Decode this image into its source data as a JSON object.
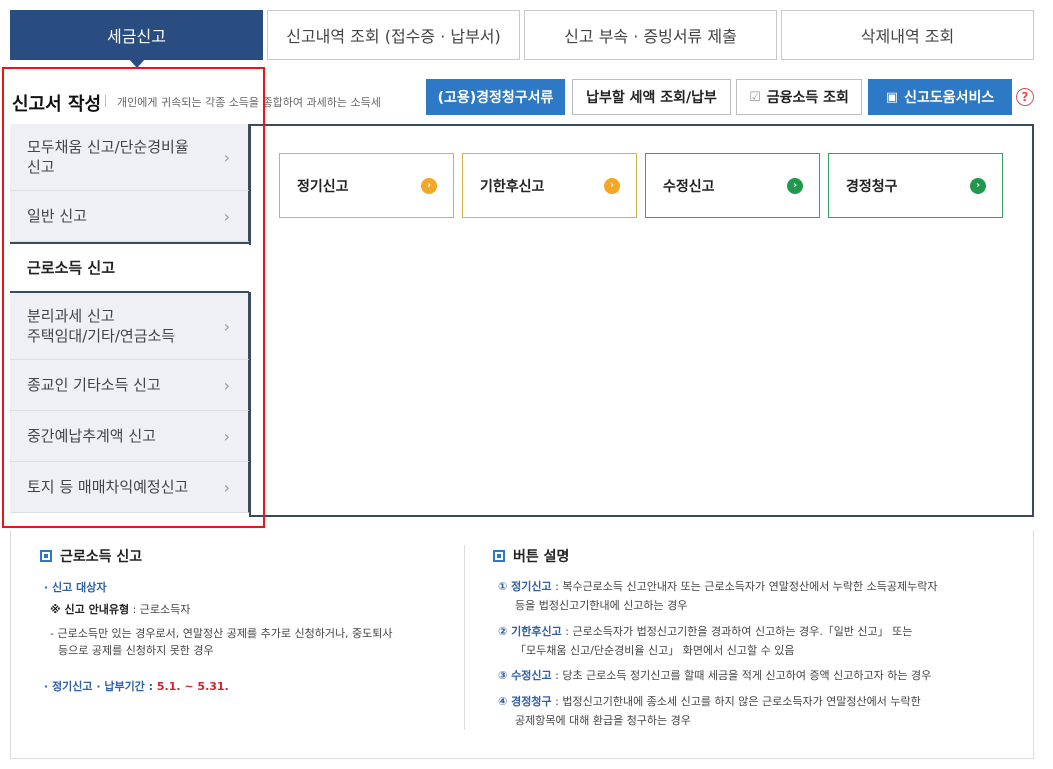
{
  "tabs": [
    {
      "label": "세금신고",
      "active": true
    },
    {
      "label": "신고내역 조회 (접수증 · 납부서)",
      "active": false
    },
    {
      "label": "신고 부속 · 증빙서류 제출",
      "active": false
    },
    {
      "label": "삭제내역 조회",
      "active": false
    }
  ],
  "header": {
    "title": "신고서 작성",
    "desc": "개인에게 귀속되는 각종 소득을 종합하여 과세하는 소득세"
  },
  "actions": {
    "claim_docs": "(고용)경정청구서류",
    "tax_payment": "납부할 세액 조회/납부",
    "finance_income": "금융소득 조회",
    "help_service": "신고도움서비스",
    "help_icon": "?"
  },
  "menu": [
    {
      "label": "모두채움 신고/단순경비율 신고"
    },
    {
      "label": "일반 신고"
    },
    {
      "label": "근로소득 신고"
    },
    {
      "label": "분리과세 신고 주택임대/기타/연금소득"
    },
    {
      "label": "종교인 기타소득 신고"
    },
    {
      "label": "중간예납추계액 신고"
    },
    {
      "label": "토지 등 매매차익예정신고"
    }
  ],
  "menu_lines": {
    "item0_line1": "모두채움 신고/단순경비율",
    "item0_line2": "신고",
    "item3_line1": "분리과세 신고",
    "item3_line2": "주택임대/기타/연금소득"
  },
  "cards": [
    {
      "label": "정기신고",
      "color": "#f5a623"
    },
    {
      "label": "기한후신고",
      "color": "#f5a623"
    },
    {
      "label": "수정신고",
      "color": "#1f9a4c"
    },
    {
      "label": "경정청구",
      "color": "#1f9a4c"
    }
  ],
  "info_left": {
    "title": "근로소득 신고",
    "target_label": "· 신고 대상자",
    "type_prefix": "※ 신고 안내유형",
    "type_value": " : 근로소득자",
    "desc1": "- 근로소득만 있는 경우로서, 연말정산 공제를 추가로 신청하거나, 중도퇴사",
    "desc2": "등으로 공제를 신청하지 못한 경우",
    "period_label": "· 정기신고 · 납부기간 : ",
    "period_value": "5.1. ~ 5.31."
  },
  "info_right": {
    "title": "버튼 설명",
    "b1_name": "① 정기신고",
    "b1_desc1": " : 복수근로소득 신고안내자 또는 근로소득자가 연말정산에서 누락한 소득공제누락자",
    "b1_desc2": "등을 법정신고기한내에 신고하는 경우",
    "b2_name": "② 기한후신고",
    "b2_desc1": " : 근로소득자가 법정신고기한을 경과하여 신고하는 경우.「일반 신고」 또는",
    "b2_desc2": "「모두채움 신고/단순경비율 신고」 화면에서 신고할 수 있음",
    "b3_name": "③ 수정신고",
    "b3_desc1": " : 당초 근로소득 정기신고를 할때 세금을 적게 신고하여 증액 신고하고자 하는 경우",
    "b4_name": "④ 경정청구",
    "b4_desc1": " : 법정신고기한내에 종소세 신고를 하지 않은 근로소득자가 연말정산에서 누락한",
    "b4_desc2": "공제항목에 대해 환급을 청구하는 경우"
  },
  "colors": {
    "tab_active": "#2a4d81",
    "button_blue": "#2e79c6",
    "highlight_red": "#e8161c"
  }
}
